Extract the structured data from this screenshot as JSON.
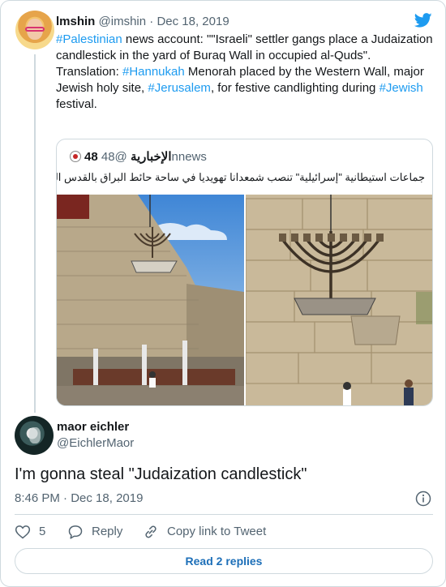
{
  "tweet": {
    "author_name": "lmshin",
    "author_handle": "@imshin",
    "separator": "·",
    "date": "Dec 18, 2019",
    "line1_hash": "#Palestinian",
    "line1_rest": " news account: \"\"Israeli\" settler gangs place a Judaization candlestick in the yard of Buraq Wall in occupied al-Quds\".",
    "line2_prefix": "Translation: ",
    "line2_hash1": "#Hannukah",
    "line2_mid1": " Menorah placed by the Western Wall, major Jewish holy site, ",
    "line2_hash2": "#Jerusalem",
    "line2_mid2": ", for festive candlighting during ",
    "line2_hash3": "#Jewish",
    "line2_end": " festival.",
    "hashtag_color": "#1d9bf0"
  },
  "quote": {
    "author_name": "48 الإخبارية",
    "author_handle": "@48nnews",
    "text": "جماعات استيطانية \"إسرائيلية\" تنصب شمعدانا تهويديا في ساحة حائط البراق بالقدس المحتلة"
  },
  "reply": {
    "author_name": "maor eichler",
    "author_handle": "@EichlerMaor",
    "text": "I'm gonna steal \"Judaization candlestick\"",
    "time": "8:46 PM",
    "separator": "·",
    "date": "Dec 18, 2019"
  },
  "actions": {
    "like_count": "5",
    "reply_label": "Reply",
    "copy_label": "Copy link to Tweet"
  },
  "read_replies_label": "Read 2 replies",
  "icons": {
    "brand": "twitter-bird-icon",
    "info": "info-icon",
    "like": "heart-icon",
    "reply": "speech-bubble-icon",
    "copy": "link-icon"
  }
}
